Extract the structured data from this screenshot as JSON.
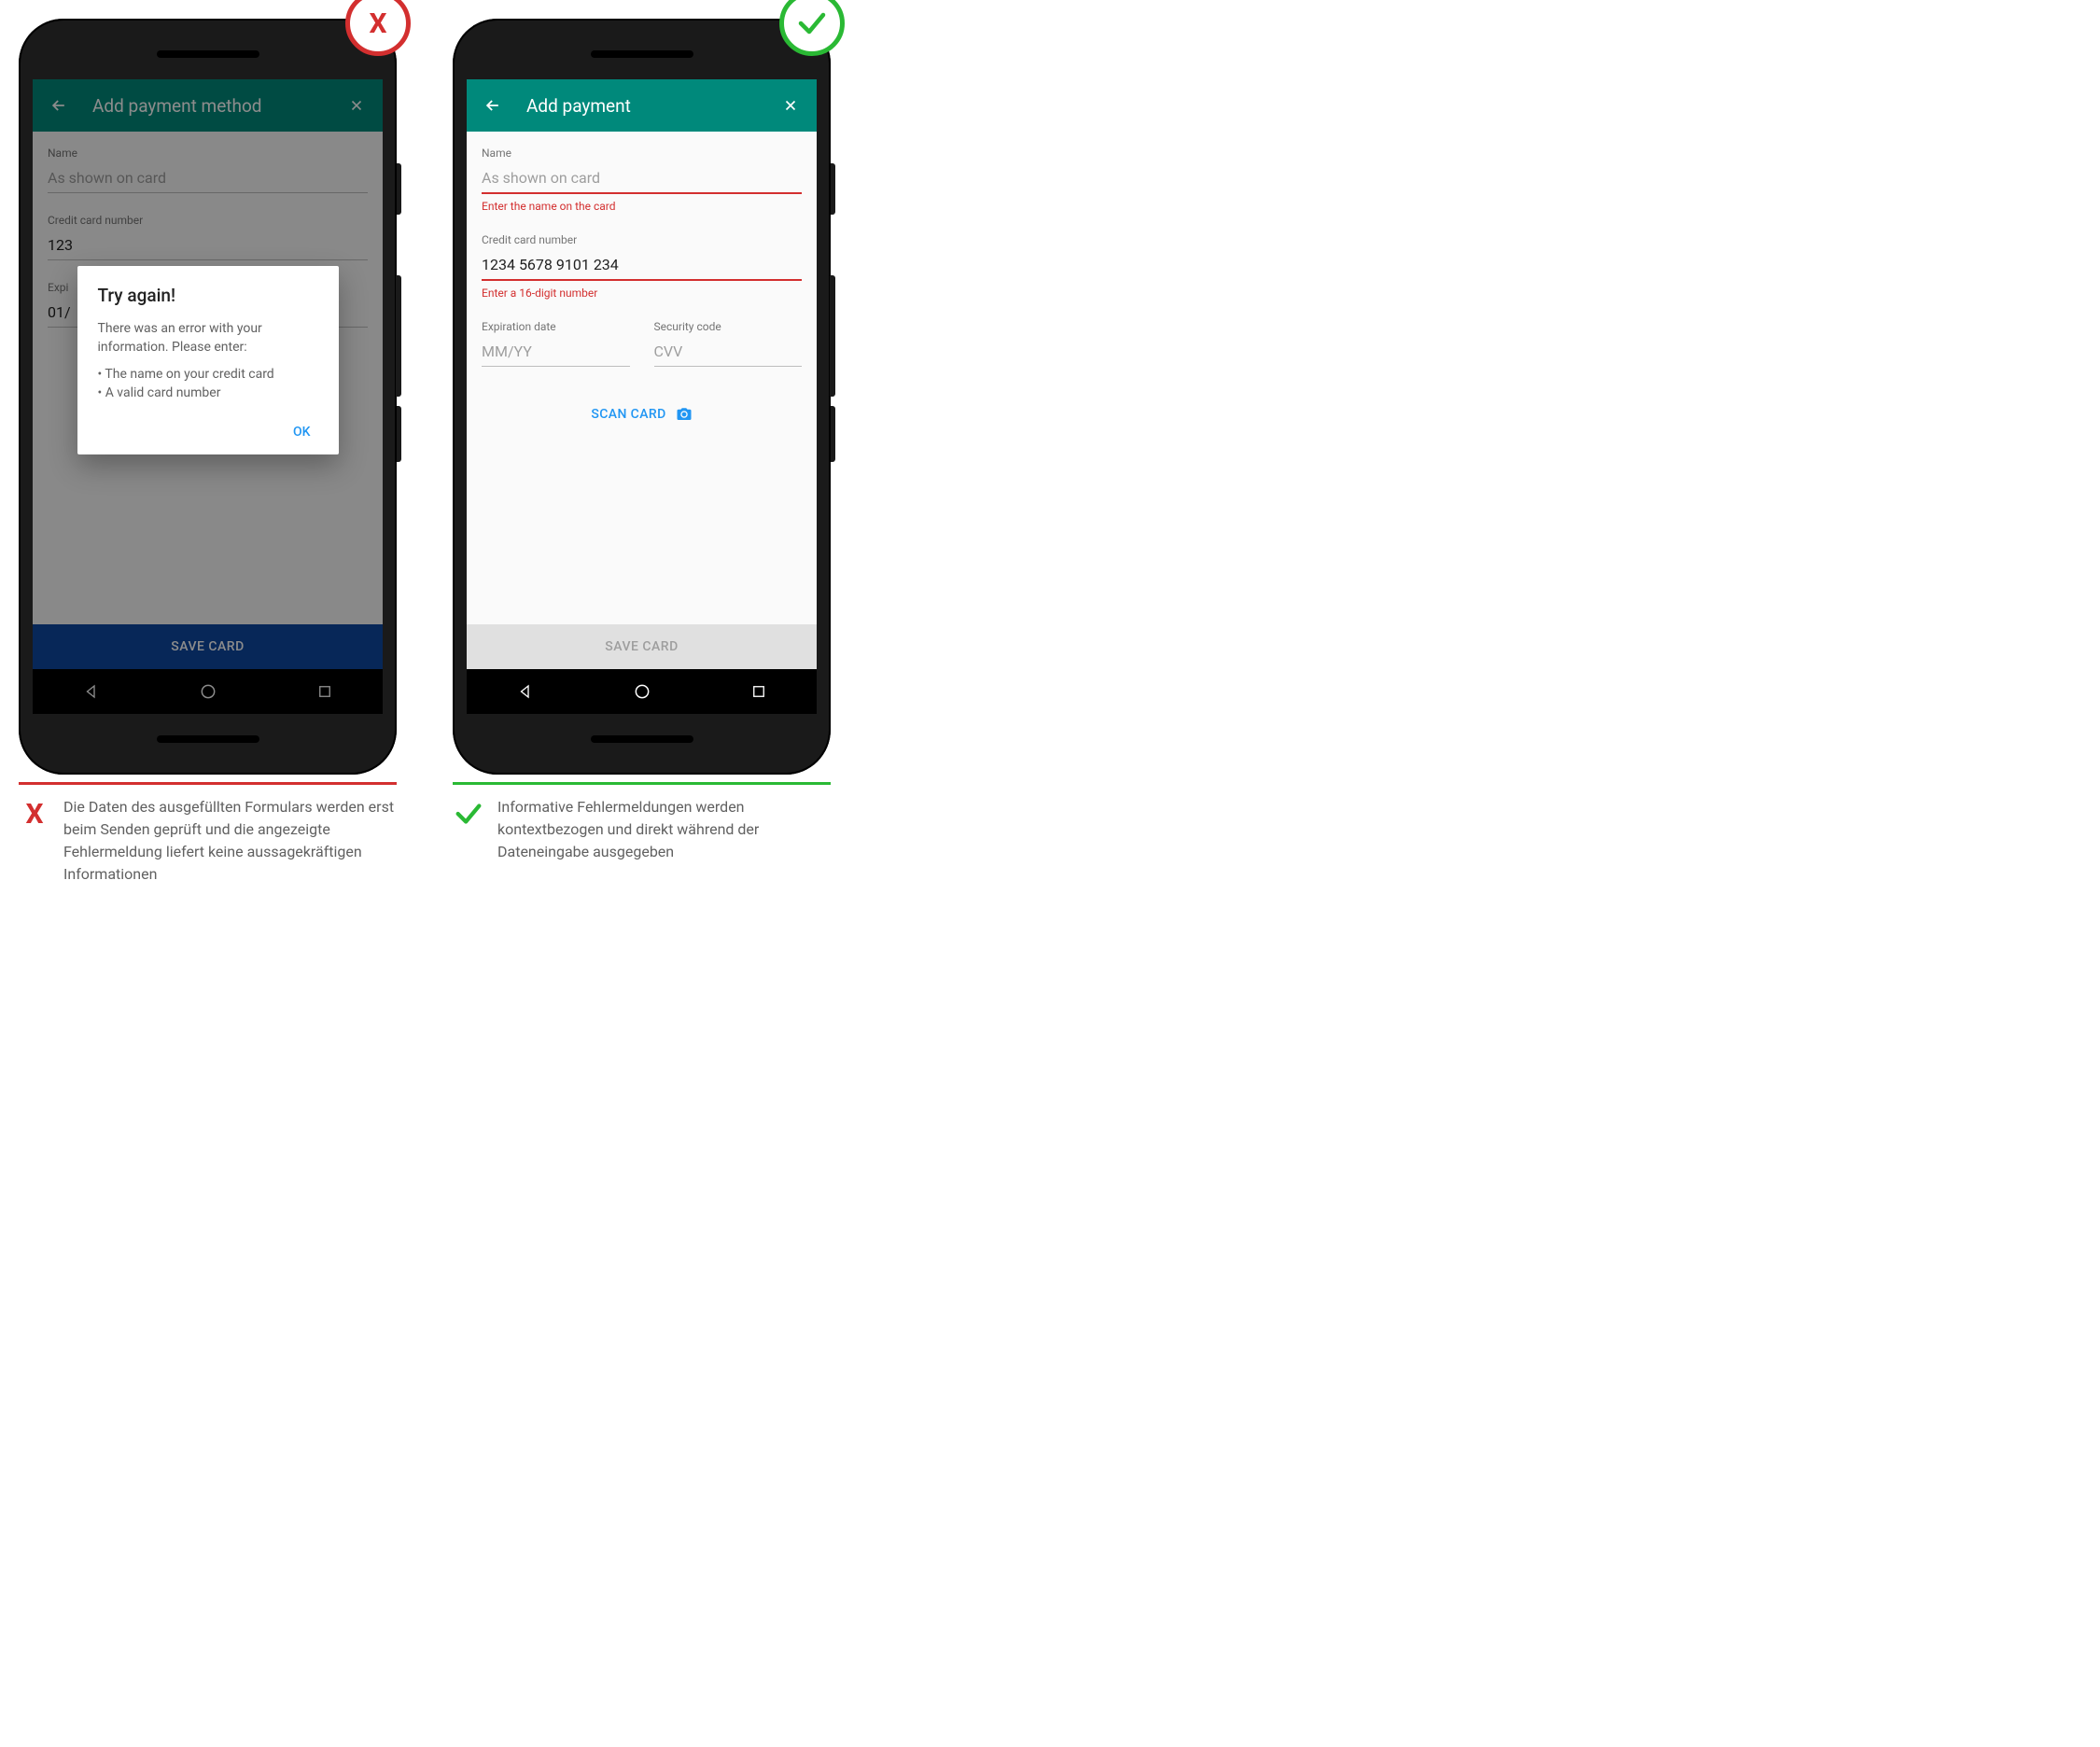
{
  "bad": {
    "app_bar_title": "Add payment method",
    "fields": {
      "name_label": "Name",
      "name_placeholder": "As shown on card",
      "cc_label": "Credit card number",
      "cc_value_partial": "123",
      "exp_label": "Expi",
      "exp_value_partial": "01/"
    },
    "dialog": {
      "title": "Try again!",
      "body": "There was an error with your information. Please enter:",
      "item1": "• The name on your credit card",
      "item2": "• A valid card number",
      "ok": "OK"
    },
    "save_label": "SAVE CARD",
    "caption": "Die Daten des ausgefüllten Formulars werden erst beim Senden geprüft und die angezeigte Fehlermeldung liefert keine aussagekräftigen Informationen",
    "badge_text": "X",
    "caption_icon": "X"
  },
  "good": {
    "app_bar_title": "Add payment",
    "fields": {
      "name_label": "Name",
      "name_placeholder": "As shown on card",
      "name_error": "Enter the name on the card",
      "cc_label": "Credit card number",
      "cc_value": "1234 5678 9101 234",
      "cc_error": "Enter a 16-digit number",
      "exp_label": "Expiration date",
      "exp_placeholder": "MM/YY",
      "sec_label": "Security code",
      "sec_placeholder": "CVV"
    },
    "scan_label": "SCAN CARD",
    "save_label": "SAVE CARD",
    "caption": "Informative Fehlermeldungen werden kontextbezogen und direkt während der Dateneingabe ausgegeben"
  }
}
